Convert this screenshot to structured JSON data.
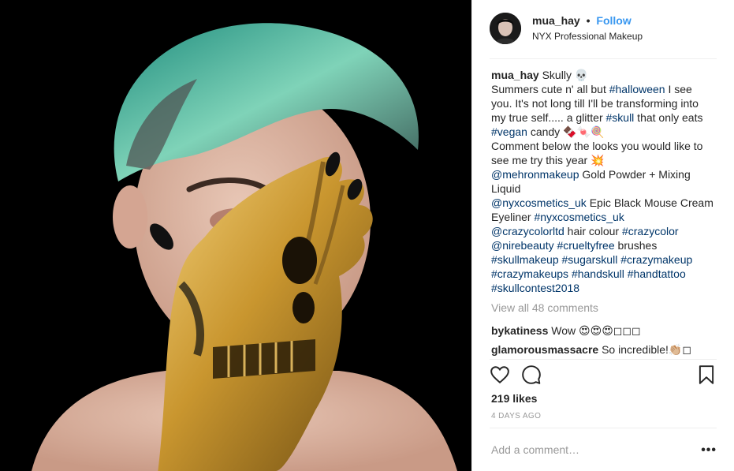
{
  "post": {
    "author": "mua_hay",
    "dot": "•",
    "follow_label": "Follow",
    "location": "NYX Professional Makeup",
    "caption": [
      {
        "t": "Skully 💀\nSummers cute n' all but ",
        "link": false
      },
      {
        "t": "#halloween",
        "link": true
      },
      {
        "t": " I see you. It's not long till I'll be transforming into my true self..... a glitter ",
        "link": false
      },
      {
        "t": "#skull",
        "link": true
      },
      {
        "t": " that only eats ",
        "link": false
      },
      {
        "t": "#vegan",
        "link": true
      },
      {
        "t": " candy 🍫🍬🍭\nComment below the looks you would like to see me try this year 💥\n",
        "link": false
      },
      {
        "t": "@mehronmakeup",
        "link": true
      },
      {
        "t": " Gold Powder + Mixing Liquid\n",
        "link": false
      },
      {
        "t": "@nyxcosmetics_uk",
        "link": true
      },
      {
        "t": " Epic Black Mouse Cream Eyeliner ",
        "link": false
      },
      {
        "t": "#nyxcosmetics_uk",
        "link": true
      },
      {
        "t": "\n",
        "link": false
      },
      {
        "t": "@crazycolorltd",
        "link": true
      },
      {
        "t": " hair colour ",
        "link": false
      },
      {
        "t": "#crazycolor",
        "link": true
      },
      {
        "t": "\n",
        "link": false
      },
      {
        "t": "@nirebeauty",
        "link": true
      },
      {
        "t": " ",
        "link": false
      },
      {
        "t": "#crueltyfree",
        "link": true
      },
      {
        "t": " brushes\n",
        "link": false
      },
      {
        "t": "#skullmakeup",
        "link": true
      },
      {
        "t": " ",
        "link": false
      },
      {
        "t": "#sugarskull",
        "link": true
      },
      {
        "t": " ",
        "link": false
      },
      {
        "t": "#crazymakeup",
        "link": true
      },
      {
        "t": "\n",
        "link": false
      },
      {
        "t": "#crazymakeups",
        "link": true
      },
      {
        "t": " ",
        "link": false
      },
      {
        "t": "#handskull",
        "link": true
      },
      {
        "t": " ",
        "link": false
      },
      {
        "t": "#handtattoo",
        "link": true
      },
      {
        "t": "\n",
        "link": false
      },
      {
        "t": "#skullcontest2018",
        "link": true
      }
    ],
    "view_all": "View all 48 comments",
    "comments": [
      {
        "user": "bykatiness",
        "text": "Wow 😍😍😍◻◻◻"
      },
      {
        "user": "glamorousmassacre",
        "text": "So incredible!👏🏼◻"
      }
    ],
    "likes": "219 likes",
    "posted_ago": "4 DAYS AGO",
    "comment_placeholder": "Add a comment…",
    "more_label": "•••"
  },
  "icons": {
    "like": "heart-outline-icon",
    "comment": "speech-bubble-icon",
    "save": "bookmark-icon",
    "more": "ellipsis-icon"
  },
  "colors": {
    "link": "#003569",
    "follow": "#3897f0",
    "muted": "#999999",
    "text": "#262626"
  }
}
